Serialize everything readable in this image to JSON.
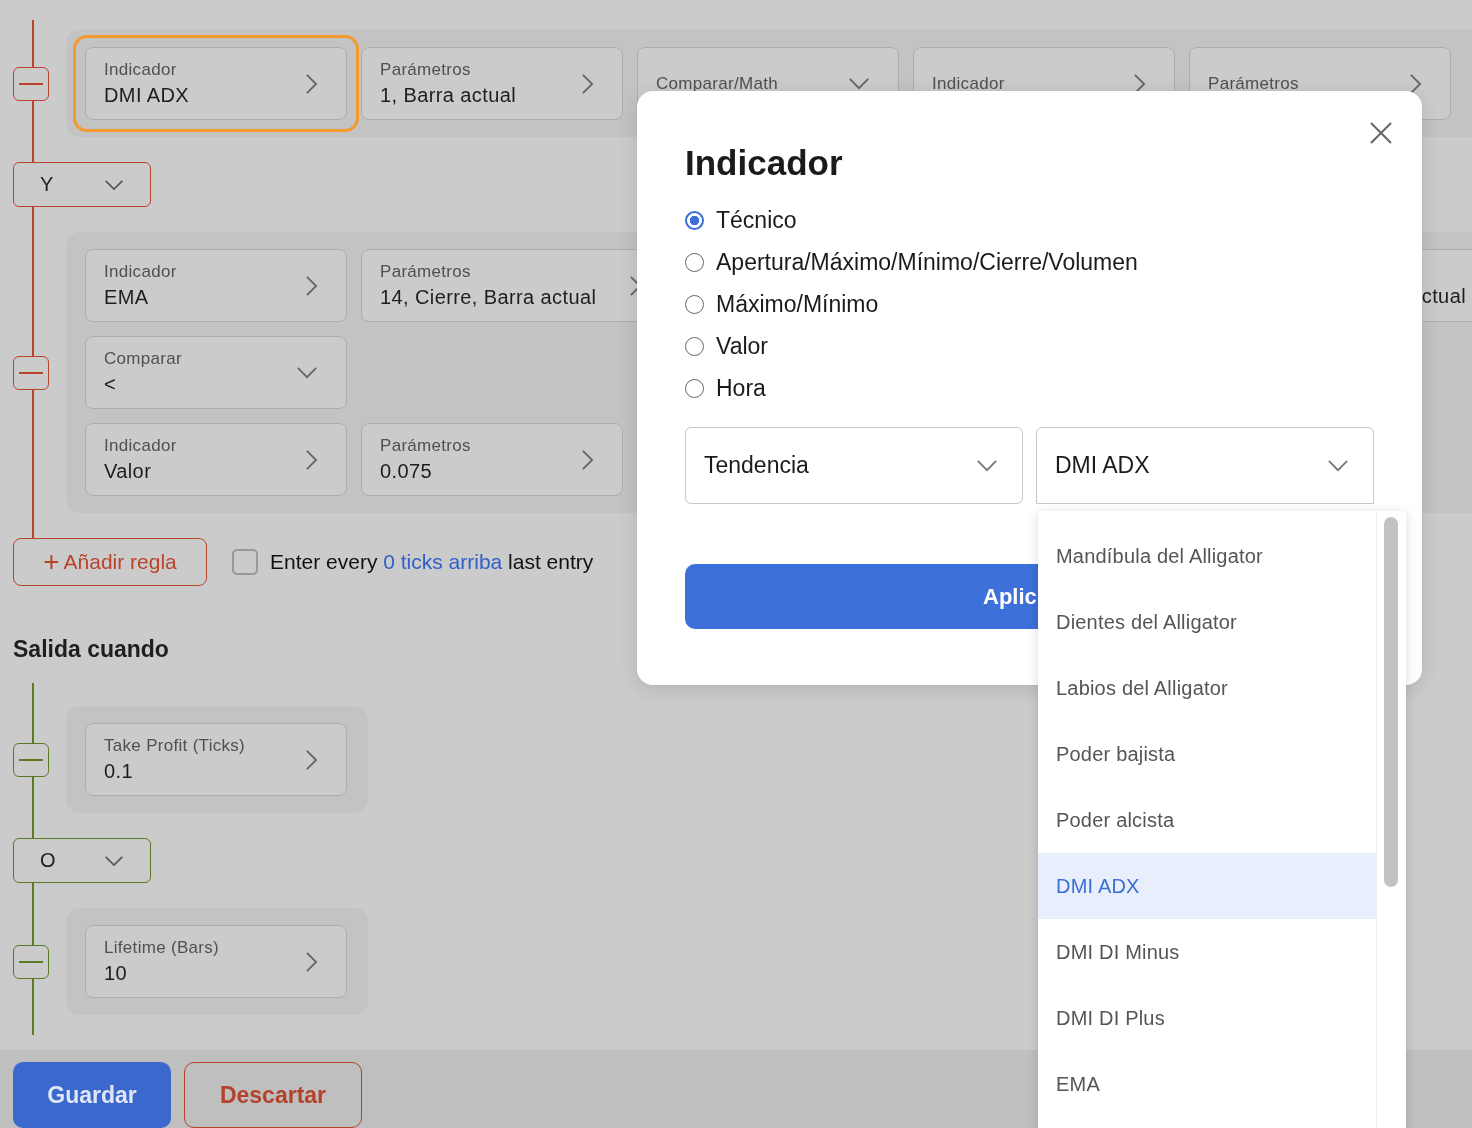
{
  "sections": [
    {
      "kind": "entry",
      "color": "#b8442c",
      "blocks": [
        {
          "kind": "group",
          "rows": [
            [
              {
                "kind": "arrow",
                "label": "Indicador",
                "value": "DMI ADX",
                "highlighted": true
              },
              {
                "kind": "arrow",
                "label": "Parámetros",
                "value": "1, Barra actual"
              },
              {
                "kind": "dropdown",
                "label": "Comparar/Math"
              },
              {
                "kind": "arrow",
                "label": "Indicador"
              },
              {
                "kind": "arrow",
                "label": "Parámetros"
              }
            ]
          ]
        },
        {
          "kind": "connector",
          "value": "Y"
        },
        {
          "kind": "group",
          "rows": [
            [
              {
                "kind": "arrow",
                "label": "Indicador",
                "value": "EMA"
              },
              {
                "kind": "arrow",
                "label": "Parámetros",
                "value": "14, Cierre, Barra actual"
              },
              {
                "kind": "fragment",
                "value": "ctual"
              }
            ],
            [
              {
                "kind": "dropdown",
                "label": "Comparar",
                "value": "<"
              }
            ],
            [
              {
                "kind": "arrow",
                "label": "Indicador",
                "value": "Valor"
              },
              {
                "kind": "arrow",
                "label": "Parámetros",
                "value": "0.075"
              }
            ]
          ]
        }
      ],
      "add_rule": {
        "icon": "+",
        "label": "Añadir regla"
      },
      "option": {
        "checked": false,
        "prefix": "Enter every",
        "link": "0 ticks arriba",
        "suffix": "last entry"
      }
    },
    {
      "kind": "exit",
      "title": "Salida cuando",
      "color": "#5b7a26",
      "blocks": [
        {
          "kind": "group",
          "rows": [
            [
              {
                "kind": "arrow",
                "label": "Take Profit (Ticks)",
                "value": "0.1"
              }
            ]
          ]
        },
        {
          "kind": "connector",
          "value": "O"
        },
        {
          "kind": "group",
          "rows": [
            [
              {
                "kind": "arrow",
                "label": "Lifetime (Bars)",
                "value": "10"
              }
            ]
          ]
        }
      ]
    }
  ],
  "footer": {
    "buttons": [
      {
        "kind": "primary",
        "label": "Guardar"
      },
      {
        "kind": "secondary",
        "label": "Descartar"
      }
    ]
  },
  "dialog": {
    "title": "Indicador",
    "radios": [
      {
        "label": "Técnico",
        "selected": true
      },
      {
        "label": "Apertura/Máximo/Mínimo/Cierre/Volumen",
        "selected": false
      },
      {
        "label": "Máximo/Mínimo",
        "selected": false
      },
      {
        "label": "Valor",
        "selected": false
      },
      {
        "label": "Hora",
        "selected": false
      }
    ],
    "selects": [
      {
        "value": "Tendencia",
        "expanded": false
      },
      {
        "value": "DMI ADX",
        "expanded": true
      }
    ],
    "apply": "Aplic",
    "options": [
      {
        "label": "Mandíbula del Alligator",
        "selected": false
      },
      {
        "label": "Dientes del Alligator",
        "selected": false
      },
      {
        "label": "Labios del Alligator",
        "selected": false
      },
      {
        "label": "Poder bajista",
        "selected": false
      },
      {
        "label": "Poder alcista",
        "selected": false
      },
      {
        "label": "DMI ADX",
        "selected": true
      },
      {
        "label": "DMI DI Minus",
        "selected": false
      },
      {
        "label": "DMI DI Plus",
        "selected": false
      },
      {
        "label": "EMA",
        "selected": false
      }
    ]
  }
}
